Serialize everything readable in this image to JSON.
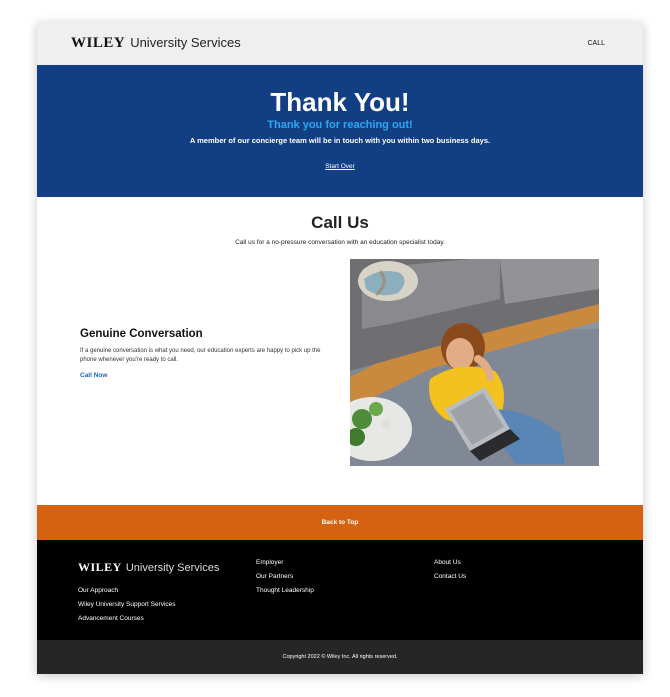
{
  "header": {
    "logo_brand": "WILEY",
    "logo_suffix": "University Services",
    "call_label": "CALL"
  },
  "hero": {
    "title": "Thank You!",
    "subtitle": "Thank you for reaching out!",
    "description": "A member of our concierge team will be in touch with you within two business days.",
    "start_over_label": "Start Over"
  },
  "call_us": {
    "title": "Call Us",
    "description": "Call us for a no-pressure conversation with an education specialist today."
  },
  "feature": {
    "title": "Genuine Conversation",
    "body": "If a genuine conversation is what you need, our education experts are happy to pick up the phone whenever you’re ready to call.",
    "cta_label": "Call Now"
  },
  "back_to_top_label": "Back to Top",
  "footer": {
    "logo_brand": "WILEY",
    "logo_suffix": "University Services",
    "col1": [
      "Our Approach",
      "Wiley University Support Services",
      "Advancement Courses"
    ],
    "col2": [
      "Employer",
      "Our Partners",
      "Thought Leadership"
    ],
    "col3": [
      "About Us",
      "Contact Us"
    ],
    "copyright": "Copyright 2022 © Wiley Inc. All rights reserved."
  },
  "colors": {
    "hero_bg": "#123f84",
    "accent_blue": "#2aa8f2",
    "back_to_top_bg": "#d46210",
    "footer_bg": "#000000"
  }
}
